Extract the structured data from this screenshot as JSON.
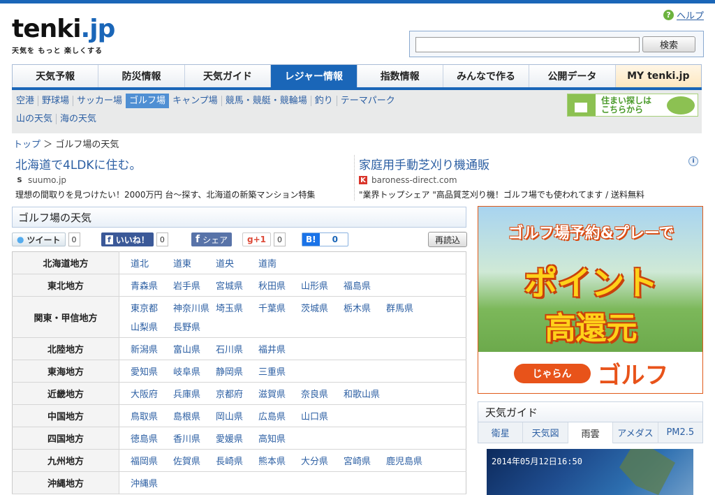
{
  "logo": {
    "main": "tenki",
    "dot": ".jp",
    "tagline": "天気を もっと 楽しくする"
  },
  "help": {
    "icon": "help-circle-icon",
    "label": "ヘルプ"
  },
  "search": {
    "value": "",
    "placeholder": "",
    "button": "検索"
  },
  "gnav": [
    {
      "label": "天気予報",
      "active": false
    },
    {
      "label": "防災情報",
      "active": false
    },
    {
      "label": "天気ガイド",
      "active": false
    },
    {
      "label": "レジャー情報",
      "active": true
    },
    {
      "label": "指数情報",
      "active": false
    },
    {
      "label": "みんなで作る",
      "active": false
    },
    {
      "label": "公開データ",
      "active": false
    },
    {
      "label": "MY tenki.jp",
      "active": false
    }
  ],
  "subnav": {
    "row1": [
      "空港",
      "野球場",
      "サッカー場",
      "ゴルフ場",
      "キャンプ場",
      "競馬・競艇・競輪場",
      "釣り",
      "テーマパーク"
    ],
    "row2": [
      "山の天気",
      "海の天気"
    ],
    "active": "ゴルフ場",
    "house_ad": "住まい探しは こちらから"
  },
  "breadcrumb": {
    "home": "トップ",
    "sep": "＞",
    "current": "ゴルフ場の天気"
  },
  "ads": [
    {
      "title": "北海道で4LDKに住む。",
      "fav": "S",
      "url": "suumo.jp",
      "desc": "理想の間取りを見つけたい！2000万円 台～探す、北海道の新築マンション特集"
    },
    {
      "title": "家庭用手動芝刈り機通販",
      "fav": "K",
      "url": "baroness-direct.com",
      "desc": "\"業界トップシェア \"高品質芝刈り機！ゴルフ場でも使われてます / 送料無料"
    }
  ],
  "ad_info": "i",
  "section_title": "ゴルフ場の天気",
  "social": {
    "tweet": "ツイート",
    "tweet_count": "0",
    "like": "いいね！",
    "like_count": "0",
    "share": "シェア",
    "gplus": "g+1",
    "gplus_count": "0",
    "hatena": "B!",
    "hatena_count": "0",
    "reload": "再読込"
  },
  "regions": [
    {
      "name": "北海道地方",
      "prefs": [
        "道北",
        "道東",
        "道央",
        "道南"
      ]
    },
    {
      "name": "東北地方",
      "prefs": [
        "青森県",
        "岩手県",
        "宮城県",
        "秋田県",
        "山形県",
        "福島県"
      ]
    },
    {
      "name": "関東・甲信地方",
      "prefs": [
        "東京都",
        "神奈川県",
        "埼玉県",
        "千葉県",
        "茨城県",
        "栃木県",
        "群馬県",
        "山梨県",
        "長野県"
      ]
    },
    {
      "name": "北陸地方",
      "prefs": [
        "新潟県",
        "富山県",
        "石川県",
        "福井県"
      ]
    },
    {
      "name": "東海地方",
      "prefs": [
        "愛知県",
        "岐阜県",
        "静岡県",
        "三重県"
      ]
    },
    {
      "name": "近畿地方",
      "prefs": [
        "大阪府",
        "兵庫県",
        "京都府",
        "滋賀県",
        "奈良県",
        "和歌山県"
      ]
    },
    {
      "name": "中国地方",
      "prefs": [
        "鳥取県",
        "島根県",
        "岡山県",
        "広島県",
        "山口県"
      ]
    },
    {
      "name": "四国地方",
      "prefs": [
        "徳島県",
        "香川県",
        "愛媛県",
        "高知県"
      ]
    },
    {
      "name": "九州地方",
      "prefs": [
        "福岡県",
        "佐賀県",
        "長崎県",
        "熊本県",
        "大分県",
        "宮崎県",
        "鹿児島県"
      ]
    },
    {
      "name": "沖縄地方",
      "prefs": [
        "沖縄県"
      ]
    }
  ],
  "golf_ad": {
    "top": "ゴルフ場予約&プレーで",
    "big1": "ポイント",
    "big2": "高還元",
    "brand": "じゃらん",
    "golf": "ゴルフ"
  },
  "guide": {
    "title": "天気ガイド",
    "tabs": [
      "衛星",
      "天気図",
      "雨雲",
      "アメダス",
      "PM2.5"
    ],
    "active_tab": "雨雲",
    "radar_time": "2014年05月12日16:50"
  },
  "colors": {
    "brand_blue": "#1a66b8",
    "link": "#2c5fa3",
    "ad_orange": "#e8531a"
  }
}
